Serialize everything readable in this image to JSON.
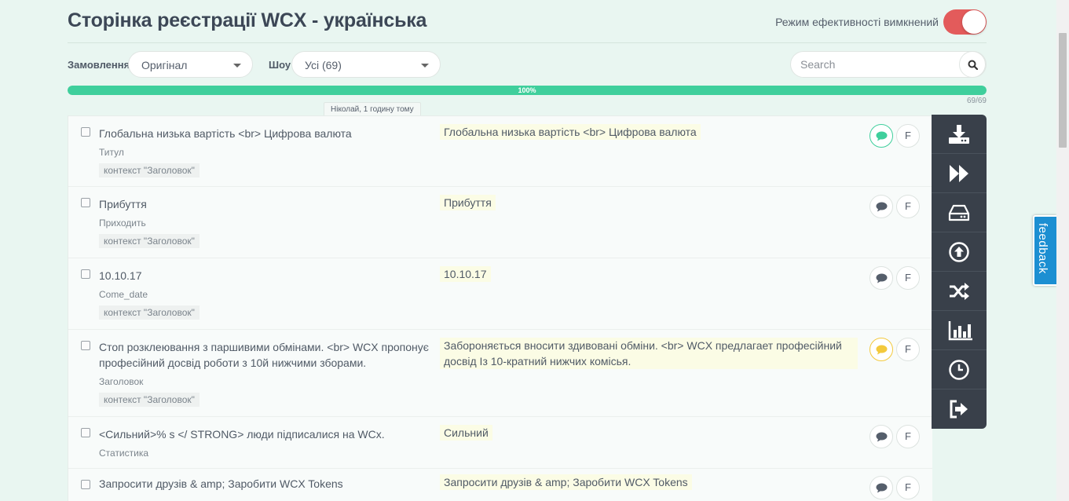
{
  "header": {
    "title": "Сторінка реєстрації WCX - українська",
    "performance_label": "Режим ефективності вимкнений"
  },
  "filters": {
    "order_label": "Замовлення",
    "order_value": "Оригінал",
    "show_label": "Шоу",
    "show_value": "Усі (69)",
    "search_placeholder": "Search"
  },
  "progress": {
    "percent_label": "100%",
    "fraction": 1.0,
    "count": "69/69",
    "tooltip": "Ніколай, 1 годину тому"
  },
  "rows": [
    {
      "source": "Глобальна низька вартість <br> Цифрова валюта",
      "key": "Титул",
      "context": "контекст  \"Заголовок\"",
      "translation": "Глобальна низька вартість <br> Цифрова валюта",
      "comment_state": "green",
      "f_label": "F"
    },
    {
      "source": "Прибуття",
      "key": "Приходить",
      "context": "контекст  \"Заголовок\"",
      "translation": "Прибуття",
      "comment_state": "none",
      "f_label": "F"
    },
    {
      "source": "10.10.17",
      "key": "Come_date",
      "context": "контекст  \"Заголовок\"",
      "translation": "10.10.17",
      "comment_state": "none",
      "f_label": "F"
    },
    {
      "source": "Стоп розклеювання з паршивими обмінами. <br> WCX пропонує професійний досвід роботи з 10й нижчими зборами.",
      "key": "Заголовок",
      "context": "контекст  \"Заголовок\"",
      "translation": "Забороняється вносити здивовані обміни. <br> WCX предлагает професійний досвід Із 10-кратний нижчих комісья.",
      "comment_state": "yellow",
      "f_label": "F"
    },
    {
      "source": "<Сильний>% s </ STRONG> люди підписалися на WCx.",
      "key": "Статистика",
      "context": "",
      "translation": "Сильний",
      "comment_state": "none",
      "f_label": "F"
    },
    {
      "source": "Запросити друзів & amp; Заробити WCX Tokens",
      "key": "",
      "context": "",
      "translation": "Запросити друзів & amp; Заробити WCX Tokens",
      "comment_state": "none",
      "f_label": "F"
    }
  ],
  "toolbar": {
    "icons": [
      "download-icon",
      "fast-forward-icon",
      "drive-icon",
      "upload-icon",
      "shuffle-icon",
      "stats-icon",
      "history-icon",
      "sign-out-icon"
    ]
  },
  "feedback": {
    "label": "feedback"
  },
  "colors": {
    "accent": "#3fcf9c",
    "toggle_off": "#e35b5b",
    "toolbar_bg": "#39404a",
    "feedback_bg": "#1c8fd2",
    "translation_bg": "#fbfce5"
  }
}
